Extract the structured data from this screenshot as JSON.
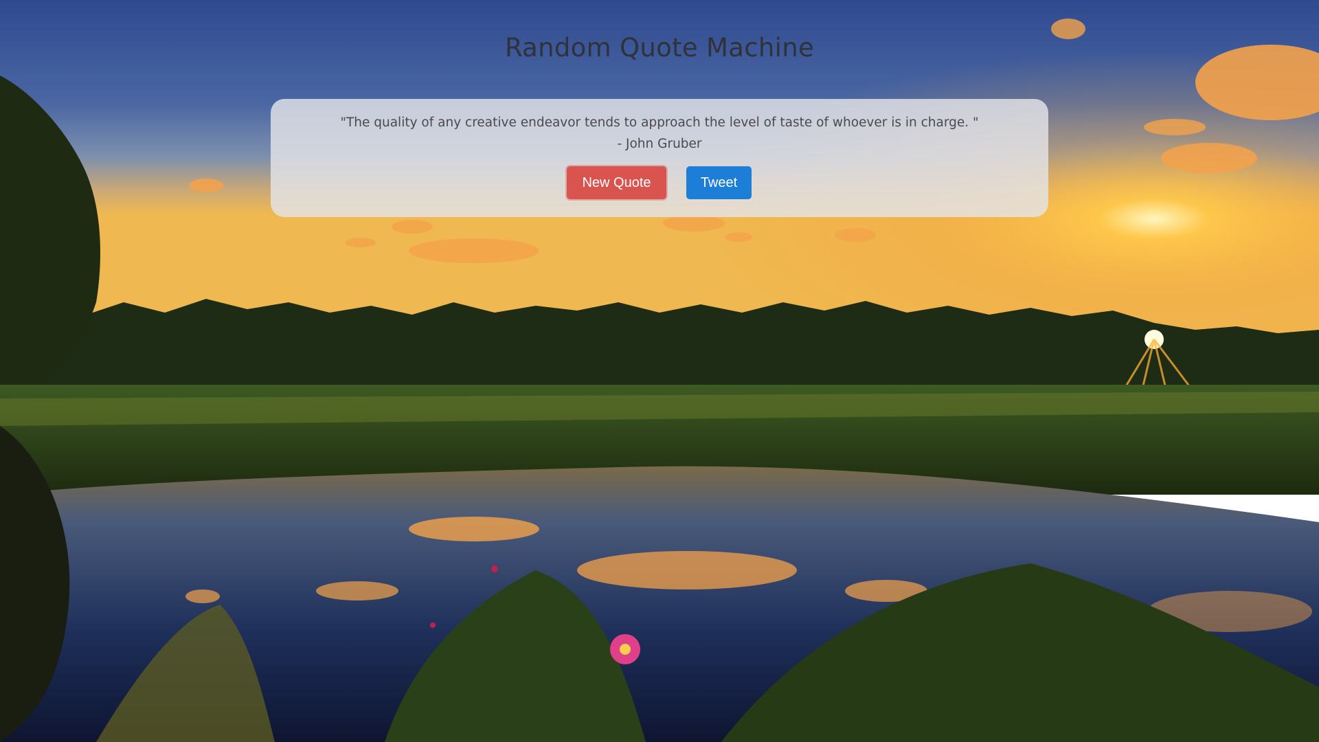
{
  "page": {
    "title": "Random Quote Machine"
  },
  "quote": {
    "text": "\"The quality of any creative endeavor tends to approach the level of taste of whoever is in charge. \"",
    "author": "- John Gruber"
  },
  "buttons": {
    "new_quote": "New Quote",
    "tweet": "Tweet"
  },
  "colors": {
    "new_quote_bg": "#d9534f",
    "tweet_bg": "#1c7ed6",
    "title_text": "#2f3238",
    "card_bg": "#e4e4e8"
  },
  "background": {
    "scene": "sunset-lake-landscape"
  }
}
